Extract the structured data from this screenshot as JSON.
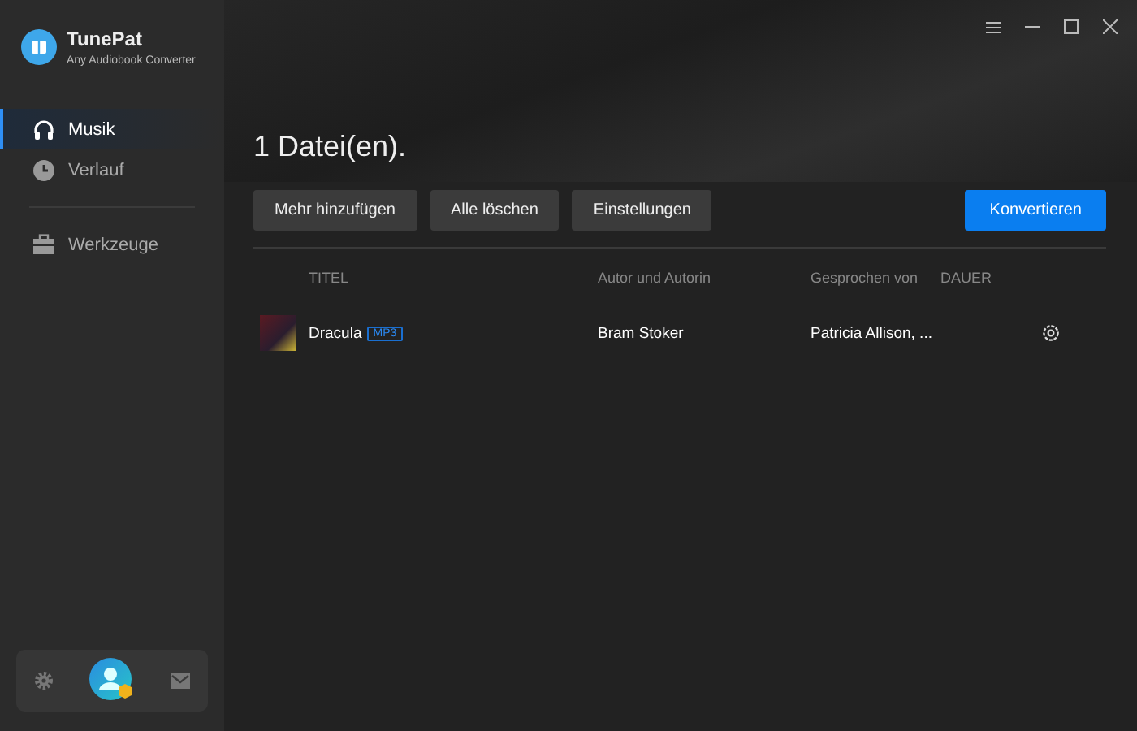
{
  "app": {
    "name": "TunePat",
    "subtitle": "Any Audiobook Converter"
  },
  "sidebar": {
    "items": [
      {
        "label": "Musik",
        "kind": "music",
        "selected": true
      },
      {
        "label": "Verlauf",
        "kind": "history",
        "selected": false
      }
    ],
    "tools": {
      "label": "Werkzeuge",
      "kind": "tools",
      "selected": false
    }
  },
  "header": {
    "title": "1 Datei(en)."
  },
  "buttons": [
    {
      "label": "Mehr hinzufügen",
      "kind": "secondary"
    },
    {
      "label": "Alle löschen",
      "kind": "secondary"
    },
    {
      "label": "Einstellungen",
      "kind": "secondary"
    },
    {
      "label": "Konvertieren",
      "kind": "primary"
    }
  ],
  "table": {
    "columns": [
      "TITEL",
      "Autor und Autorin",
      "Gesprochen von",
      "DAUER"
    ],
    "rows": [
      {
        "title": "Dracula",
        "format": "MP3",
        "author": "Bram Stoker",
        "narrator": "Patricia Allison, ..."
      }
    ]
  }
}
